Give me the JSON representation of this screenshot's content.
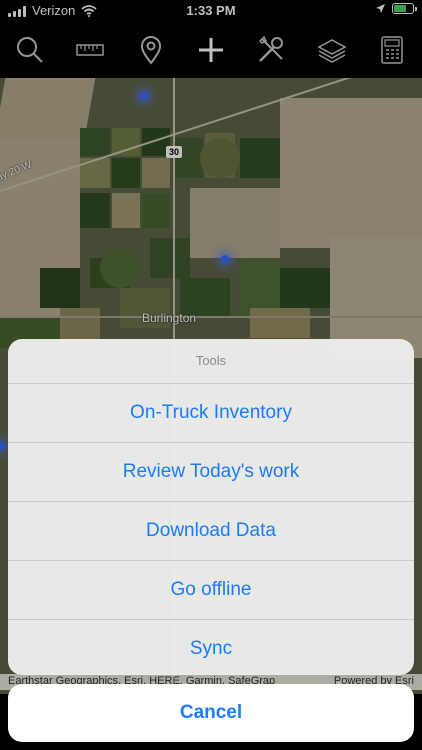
{
  "status_bar": {
    "carrier": "Verizon",
    "time": "1:33 PM",
    "battery_level": 0.7,
    "battery_color": "#4cd964"
  },
  "toolbar": {
    "icons": [
      "search-icon",
      "ruler-icon",
      "location-pin-icon",
      "add-icon",
      "tools-icon",
      "layers-icon",
      "calculator-icon"
    ]
  },
  "map": {
    "place_label": "Burlington",
    "road_shield": "30",
    "highway_label": "ay 20 W"
  },
  "attribution": {
    "left": "Earthstar Geographics, Esri, HERE, Garmin, SafeGrap",
    "right": "Powered by Esri"
  },
  "action_sheet": {
    "title": "Tools",
    "items": [
      "On-Truck Inventory",
      "Review Today's work",
      "Download Data",
      "Go offline",
      "Sync"
    ],
    "cancel_label": "Cancel",
    "accent_color": "#1b7cf5"
  }
}
